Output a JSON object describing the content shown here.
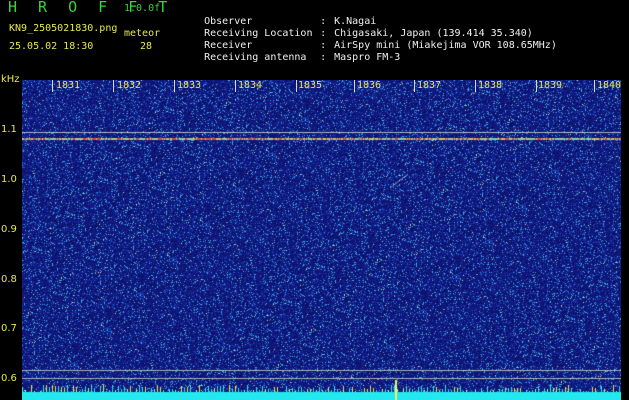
{
  "app": {
    "title": "H R O F F T",
    "version": "1.0.0f",
    "filename": "KN9_2505021830.png",
    "mode": "meteor",
    "datetime": "25.05.02 18:30",
    "count": "28"
  },
  "info": [
    {
      "label": "Observer",
      "value": "K.Nagai"
    },
    {
      "label": "Receiving Location",
      "value": "Chigasaki, Japan (139.414 35.340)"
    },
    {
      "label": "Receiver",
      "value": "AirSpy mini (Miakejima VOR 108.65MHz)"
    },
    {
      "label": "Receiving antenna",
      "value": "Maspro FM-3"
    }
  ],
  "info_separator": ":",
  "axis": {
    "unit": "kHz",
    "y_labels": [
      "1.1",
      "1.0",
      "0.9",
      "0.8",
      "0.7",
      "0.6"
    ],
    "minute_labels": [
      "1831",
      "1832",
      "1833",
      "1834",
      "1835",
      "1836",
      "1837",
      "1838",
      "1839",
      "1840"
    ]
  },
  "colors": {
    "background": "#000000",
    "plot_background": "#13187a",
    "label_yellow": "#e8e84a",
    "label_green": "#3cd13c",
    "signal_line": "#d24a4a"
  }
}
